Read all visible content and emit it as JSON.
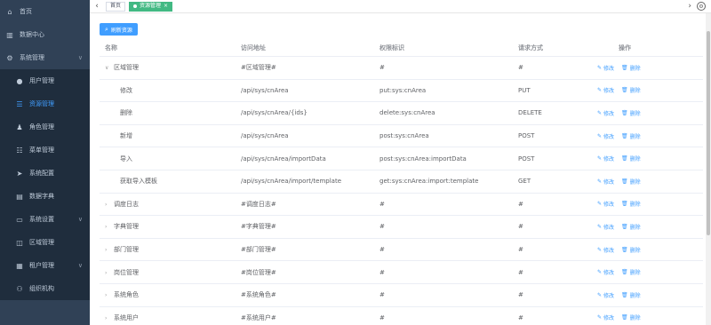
{
  "sidebar": {
    "items": [
      {
        "label": "首页",
        "icon": "home-icon",
        "glyph": "⌂",
        "level": 0,
        "active": false,
        "arrow": ""
      },
      {
        "label": "数据中心",
        "icon": "chart-icon",
        "glyph": "▥",
        "level": 0,
        "active": false,
        "arrow": ""
      },
      {
        "label": "系统管理",
        "icon": "gear-icon",
        "glyph": "⚙",
        "level": 0,
        "active": false,
        "arrow": "∨"
      },
      {
        "label": "用户管理",
        "icon": "user-icon",
        "glyph": "●",
        "level": 1,
        "active": false,
        "arrow": ""
      },
      {
        "label": "资源管理",
        "icon": "list-icon",
        "glyph": "☰",
        "level": 1,
        "active": true,
        "arrow": ""
      },
      {
        "label": "角色管理",
        "icon": "people-icon",
        "glyph": "♟",
        "level": 1,
        "active": false,
        "arrow": ""
      },
      {
        "label": "菜单管理",
        "icon": "menu-icon",
        "glyph": "☷",
        "level": 1,
        "active": false,
        "arrow": ""
      },
      {
        "label": "系统配置",
        "icon": "send-icon",
        "glyph": "➤",
        "level": 1,
        "active": false,
        "arrow": ""
      },
      {
        "label": "数据字典",
        "icon": "book-icon",
        "glyph": "▤",
        "level": 1,
        "active": false,
        "arrow": ""
      },
      {
        "label": "系统设置",
        "icon": "monitor-icon",
        "glyph": "▭",
        "level": 1,
        "active": false,
        "arrow": "∨"
      },
      {
        "label": "区域管理",
        "icon": "window-icon",
        "glyph": "◫",
        "level": 1,
        "active": false,
        "arrow": ""
      },
      {
        "label": "租户管理",
        "icon": "tenant-icon",
        "glyph": "▦",
        "level": 1,
        "active": false,
        "arrow": "∨"
      },
      {
        "label": "组织机构",
        "icon": "org-icon",
        "glyph": "⚇",
        "level": 1,
        "active": false,
        "arrow": ""
      }
    ]
  },
  "tags": {
    "nav_left": "‹",
    "nav_right": "›",
    "settings": "⚙",
    "home": "首页",
    "active": "资源管理",
    "close": "×"
  },
  "toolbar": {
    "refresh_label": "刷新资源",
    "refresh_icon": "⌕"
  },
  "table": {
    "headers": [
      "名称",
      "访问地址",
      "权限标识",
      "请求方式",
      "操作"
    ],
    "edit_label": "修改",
    "delete_label": "删除",
    "edit_icon": "✎",
    "delete_icon": "🗑",
    "rows": [
      {
        "name": "区域管理",
        "url": "#区域管理#",
        "perm": "#",
        "method": "#",
        "expander": "∨",
        "child": false
      },
      {
        "name": "修改",
        "url": "/api/sys/cnArea",
        "perm": "put:sys:cnArea",
        "method": "PUT",
        "expander": "",
        "child": true
      },
      {
        "name": "删除",
        "url": "/api/sys/cnArea/{ids}",
        "perm": "delete:sys:cnArea",
        "method": "DELETE",
        "expander": "",
        "child": true
      },
      {
        "name": "新增",
        "url": "/api/sys/cnArea",
        "perm": "post:sys:cnArea",
        "method": "POST",
        "expander": "",
        "child": true
      },
      {
        "name": "导入",
        "url": "/api/sys/cnArea/importData",
        "perm": "post:sys:cnArea:importData",
        "method": "POST",
        "expander": "",
        "child": true
      },
      {
        "name": "获取导入模板",
        "url": "/api/sys/cnArea/import/template",
        "perm": "get:sys:cnArea:import:template",
        "method": "GET",
        "expander": "",
        "child": true
      },
      {
        "name": "调度日志",
        "url": "#调度日志#",
        "perm": "#",
        "method": "#",
        "expander": "›",
        "child": false
      },
      {
        "name": "字典管理",
        "url": "#字典管理#",
        "perm": "#",
        "method": "#",
        "expander": "›",
        "child": false
      },
      {
        "name": "部门管理",
        "url": "#部门管理#",
        "perm": "#",
        "method": "#",
        "expander": "›",
        "child": false
      },
      {
        "name": "岗位管理",
        "url": "#岗位管理#",
        "perm": "#",
        "method": "#",
        "expander": "›",
        "child": false
      },
      {
        "name": "系统角色",
        "url": "#系统角色#",
        "perm": "#",
        "method": "#",
        "expander": "›",
        "child": false
      },
      {
        "name": "系统用户",
        "url": "#系统用户#",
        "perm": "#",
        "method": "#",
        "expander": "›",
        "child": false
      }
    ]
  },
  "colors": {
    "sidebar_bg": "#304156",
    "accent": "#409eff",
    "tag_active": "#42b983"
  }
}
